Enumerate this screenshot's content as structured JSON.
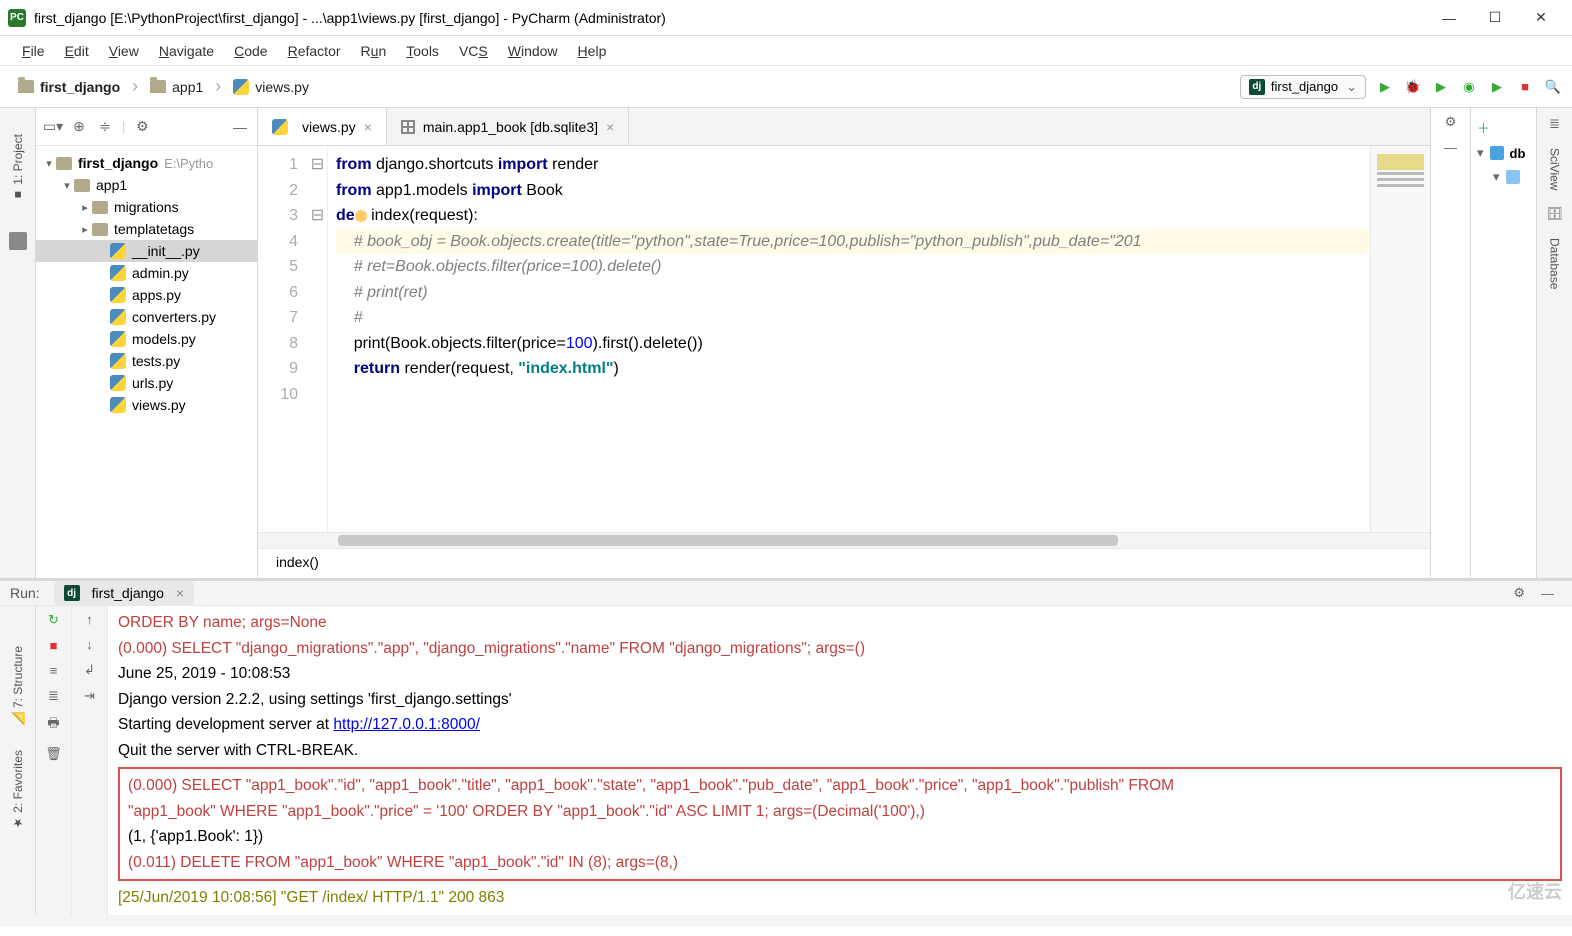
{
  "window": {
    "title": "first_django [E:\\PythonProject\\first_django] - ...\\app1\\views.py [first_django] - PyCharm (Administrator)"
  },
  "menubar": [
    "File",
    "Edit",
    "View",
    "Navigate",
    "Code",
    "Refactor",
    "Run",
    "Tools",
    "VCS",
    "Window",
    "Help"
  ],
  "breadcrumbs": [
    "first_django",
    "app1",
    "views.py"
  ],
  "run_config": {
    "name": "first_django"
  },
  "project_panel": {
    "root": {
      "name": "first_django",
      "path": "E:\\Pytho"
    },
    "tree": [
      {
        "indent": 0,
        "arrow": "▾",
        "icon": "folder",
        "label": "first_django",
        "suffix": "E:\\Pytho"
      },
      {
        "indent": 1,
        "arrow": "▾",
        "icon": "folder",
        "label": "app1"
      },
      {
        "indent": 2,
        "arrow": "▸",
        "icon": "folder",
        "label": "migrations"
      },
      {
        "indent": 2,
        "arrow": "▸",
        "icon": "folder",
        "label": "templatetags"
      },
      {
        "indent": 3,
        "arrow": "",
        "icon": "py",
        "label": "__init__.py",
        "selected": true
      },
      {
        "indent": 3,
        "arrow": "",
        "icon": "py",
        "label": "admin.py"
      },
      {
        "indent": 3,
        "arrow": "",
        "icon": "py",
        "label": "apps.py"
      },
      {
        "indent": 3,
        "arrow": "",
        "icon": "py",
        "label": "converters.py"
      },
      {
        "indent": 3,
        "arrow": "",
        "icon": "py",
        "label": "models.py"
      },
      {
        "indent": 3,
        "arrow": "",
        "icon": "py",
        "label": "tests.py"
      },
      {
        "indent": 3,
        "arrow": "",
        "icon": "py",
        "label": "urls.py"
      },
      {
        "indent": 3,
        "arrow": "",
        "icon": "py",
        "label": "views.py"
      }
    ]
  },
  "editor": {
    "tabs": [
      {
        "label": "views.py",
        "icon": "py",
        "active": true
      },
      {
        "label": "main.app1_book [db.sqlite3]",
        "icon": "table",
        "active": false
      }
    ],
    "line_count": 10,
    "breadcrumb": "index()",
    "code": {
      "l1_pre": "from",
      "l1_mid": " django.shortcuts ",
      "l1_imp": "import",
      "l1_post": " render",
      "l2_pre": "from",
      "l2_mid": " app1.models ",
      "l2_imp": "import",
      "l2_post": " Book",
      "l3_def": "de",
      "l3_rest": " index(request):",
      "l4": "    # book_obj = Book.objects.create(title=\"python\",state=True,price=100,publish=\"python_publish\",pub_date=\"201",
      "l5": "    # ret=Book.objects.filter(price=100).delete()",
      "l6": "    # print(ret)",
      "l7": "    #",
      "l8_a": "    print(Book.objects.filter(",
      "l8_b": "price",
      "l8_c": "=",
      "l8_d": "100",
      "l8_e": ").first().delete())",
      "l9_a": "    ",
      "l9_ret": "return",
      "l9_b": " render(request, ",
      "l9_str": "\"index.html\"",
      "l9_c": ")"
    }
  },
  "db_panel": {
    "root": "db"
  },
  "run_panel": {
    "label": "Run:",
    "tab": "first_django",
    "lines": {
      "a": "           ORDER BY name; args=None",
      "b": "(0.000) SELECT \"django_migrations\".\"app\", \"django_migrations\".\"name\" FROM \"django_migrations\"; args=()",
      "c": "June 25, 2019 - 10:08:53",
      "d": "Django version 2.2.2, using settings 'first_django.settings'",
      "e_pre": "Starting development server at ",
      "e_link": "http://127.0.0.1:8000/",
      "f": "Quit the server with CTRL-BREAK.",
      "g1": "(0.000) SELECT \"app1_book\".\"id\", \"app1_book\".\"title\", \"app1_book\".\"state\", \"app1_book\".\"pub_date\", \"app1_book\".\"price\", \"app1_book\".\"publish\" FROM",
      "g2": " \"app1_book\" WHERE \"app1_book\".\"price\" = '100' ORDER BY \"app1_book\".\"id\" ASC  LIMIT 1; args=(Decimal('100'),)",
      "g3": "(1, {'app1.Book': 1})",
      "g4": "(0.011) DELETE FROM \"app1_book\" WHERE \"app1_book\".\"id\" IN (8); args=(8,)",
      "h": "[25/Jun/2019 10:08:56] \"GET /index/ HTTP/1.1\" 200 863"
    }
  },
  "left_tabs": [
    "1: Project"
  ],
  "left_tabs2": [
    "7: Structure",
    "2: Favorites"
  ],
  "right_tabs": [
    "SciView",
    "Database"
  ],
  "watermark": "亿速云"
}
